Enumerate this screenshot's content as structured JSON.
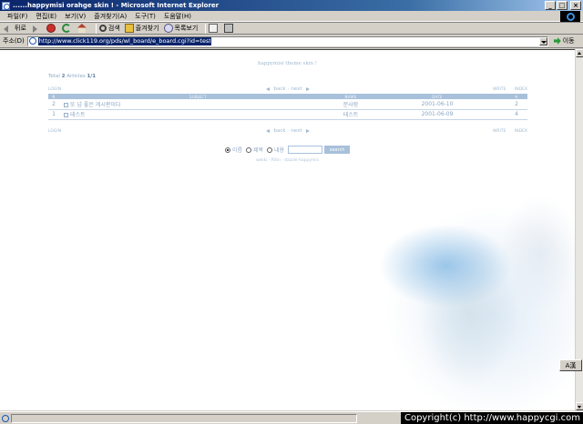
{
  "window": {
    "title": "......happymisi orahge skin ! - Microsoft Internet Explorer",
    "min": "_",
    "max": "□",
    "close": "×"
  },
  "menu": [
    "파일(F)",
    "편집(E)",
    "보기(V)",
    "즐겨찾기(A)",
    "도구(T)",
    "도움말(H)"
  ],
  "toolbar": {
    "back": "뒤로",
    "search": "검색",
    "favorites": "즐겨찾기",
    "history": "목록보기"
  },
  "address": {
    "label": "주소(D)",
    "url": "http://www.click119.org/pds/wl_board/e_board.cgi?id=test",
    "go": "이동"
  },
  "board": {
    "title": "happymisi theme skin !",
    "total_prefix": "Total",
    "total_count": "2",
    "total_mid": "Articles",
    "page": "1/1",
    "login": "LOGIN",
    "write": "WRITE",
    "index": "INDEX",
    "back": "back",
    "next": "next",
    "columns": [
      "N",
      "SUBJECT",
      "NAME",
      "DATE",
      "H"
    ],
    "rows": [
      {
        "no": "2",
        "subject": "또 넘 좋은 게시판이다",
        "name": "문사랑",
        "date": "2001-06-10",
        "hit": "2"
      },
      {
        "no": "1",
        "subject": "테스트",
        "name": "테스트",
        "date": "2001-06-09",
        "hit": "4"
      }
    ],
    "search": {
      "options": [
        "이름",
        "제목",
        "내용"
      ],
      "selected": 0,
      "button": "search"
    },
    "credit": "wwiki · Ritin · dazzle happymis"
  },
  "status": {
    "copyright": "Copyright(c) http://www.happycgi.com"
  },
  "ime": "A漢",
  "colors": {
    "board_accent": "#a8c0da",
    "title_bar": "#0a246a"
  }
}
